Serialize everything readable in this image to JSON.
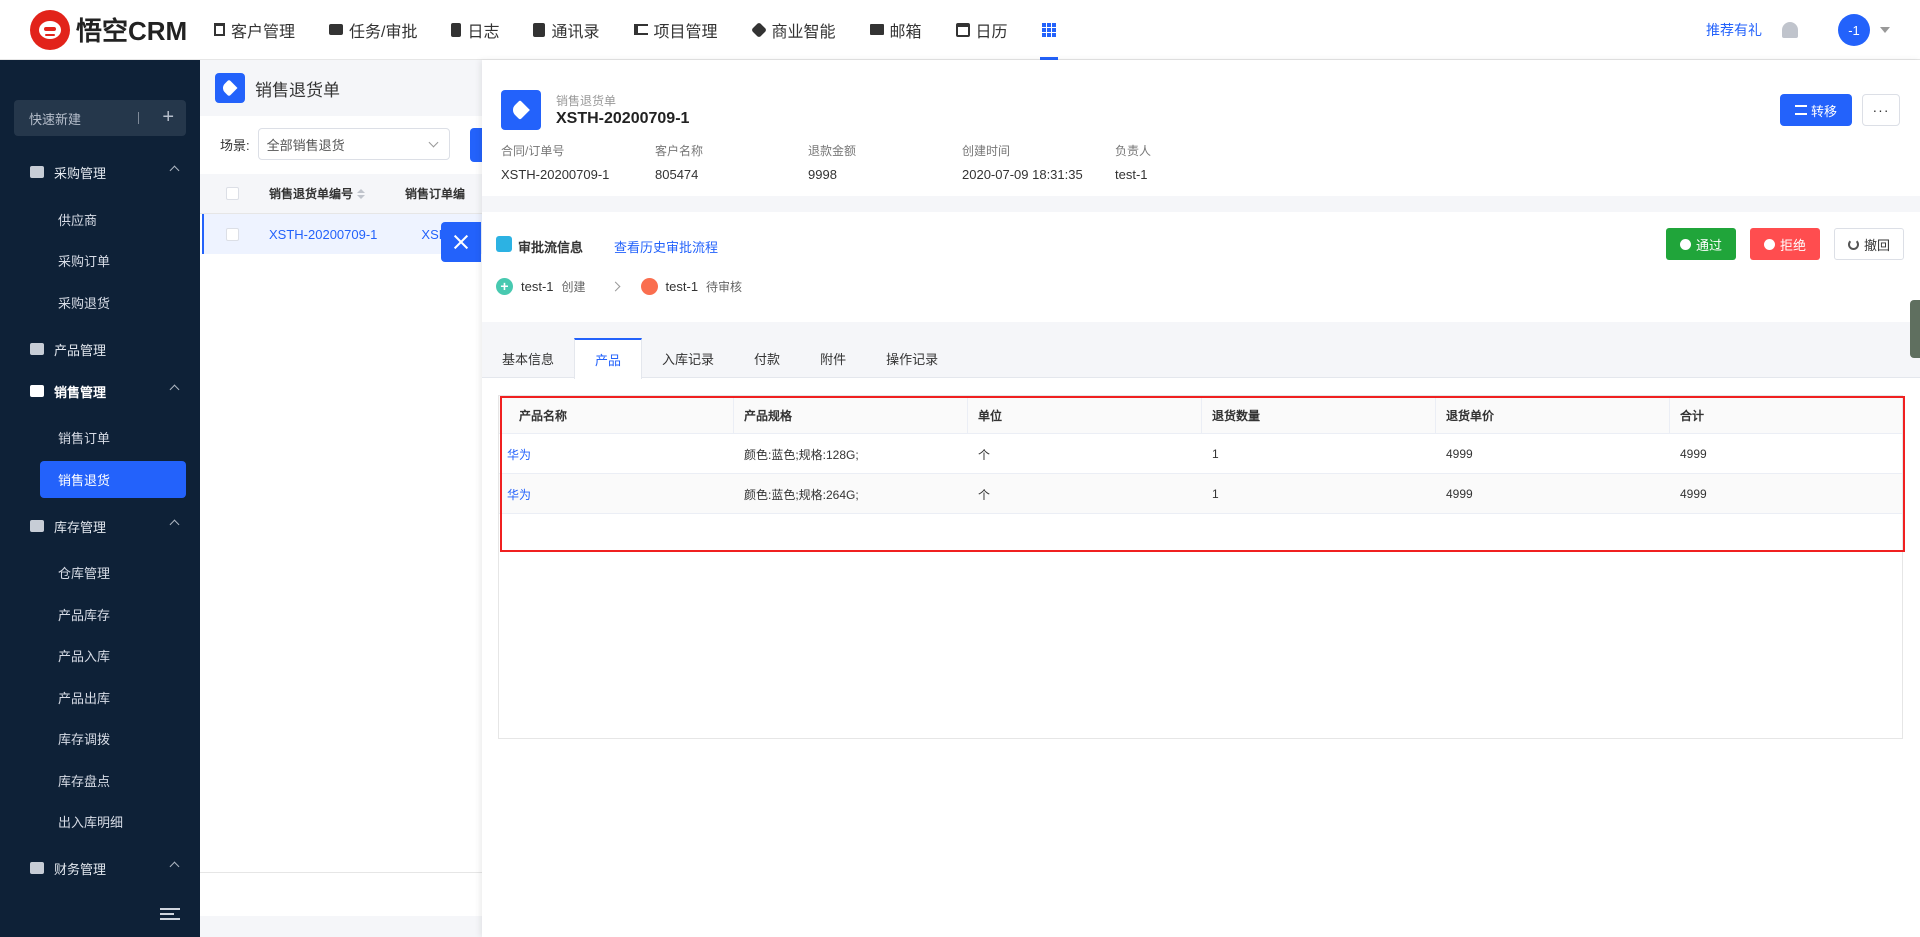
{
  "app": {
    "logo_text": "悟空CRM"
  },
  "topnav": {
    "items": [
      {
        "label": "客户管理",
        "icon": "building-icon"
      },
      {
        "label": "任务/审批",
        "icon": "briefcase-icon"
      },
      {
        "label": "日志",
        "icon": "document-icon"
      },
      {
        "label": "通讯录",
        "icon": "phone-book-icon"
      },
      {
        "label": "项目管理",
        "icon": "list-icon"
      },
      {
        "label": "商业智能",
        "icon": "cube-icon"
      },
      {
        "label": "邮箱",
        "icon": "mail-icon"
      },
      {
        "label": "日历",
        "icon": "calendar-icon"
      }
    ],
    "apps_icon": "grid-icon",
    "recommend": "推荐有礼",
    "avatar_text": "-1"
  },
  "sidebar": {
    "quick_new": "快速新建",
    "groups": [
      {
        "label": "采购管理",
        "icon": "cart-icon",
        "subs": [
          "供应商",
          "采购订单",
          "采购退货"
        ]
      },
      {
        "label": "产品管理",
        "icon": "box-icon",
        "subs": []
      },
      {
        "label": "销售管理",
        "icon": "tag-icon",
        "subs": [
          "销售订单",
          "销售退货"
        ]
      },
      {
        "label": "库存管理",
        "icon": "archive-icon",
        "subs": [
          "仓库管理",
          "产品库存",
          "产品入库",
          "产品出库",
          "库存调拨",
          "库存盘点",
          "出入库明细"
        ]
      },
      {
        "label": "财务管理",
        "icon": "wallet-icon",
        "subs": []
      }
    ],
    "active_sub": "销售退货"
  },
  "list": {
    "title": "销售退货单",
    "scene_label": "场景:",
    "scene_value": "全部销售退货",
    "col1": "销售退货单编号",
    "col2": "销售订单编",
    "row_num": "XSTH-20200709-1",
    "row_col2": "XSD"
  },
  "detail": {
    "doc_type": "销售退货单",
    "doc_number": "XSTH-20200709-1",
    "transfer_label": "转移",
    "more_label": "···",
    "fields": [
      {
        "label": "合同/订单号",
        "value": "XSTH-20200709-1"
      },
      {
        "label": "客户名称",
        "value": "805474"
      },
      {
        "label": "退款金额",
        "value": "9998"
      },
      {
        "label": "创建时间",
        "value": "2020-07-09 18:31:35"
      },
      {
        "label": "负责人",
        "value": "test-1"
      }
    ],
    "approval": {
      "title": "审批流信息",
      "history_link": "查看历史审批流程",
      "pass": "通过",
      "reject": "拒绝",
      "revoke": "撤回",
      "steps": [
        {
          "name": "test-1",
          "status": "创建"
        },
        {
          "name": "test-1",
          "status": "待审核"
        }
      ]
    },
    "tabs": [
      "基本信息",
      "产品",
      "入库记录",
      "付款",
      "附件",
      "操作记录"
    ],
    "active_tab": "产品",
    "table": {
      "headers": [
        "产品名称",
        "产品规格",
        "单位",
        "退货数量",
        "退货单价",
        "合计"
      ],
      "rows": [
        [
          "华为",
          "颜色:蓝色;规格:128G;",
          "个",
          "1",
          "4999",
          "4999"
        ],
        [
          "华为",
          "颜色:蓝色;规格:264G;",
          "个",
          "1",
          "4999",
          "4999"
        ]
      ]
    }
  },
  "colors": {
    "primary": "#2362fb",
    "sidebar_bg": "#0e2137",
    "pass": "#20a53a",
    "reject": "#ff4d4f",
    "highlight_border": "#f02020"
  }
}
